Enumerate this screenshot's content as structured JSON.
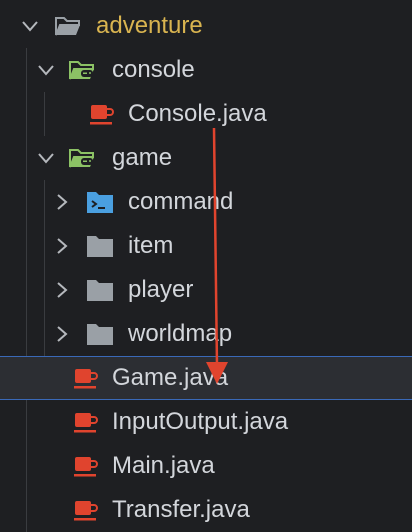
{
  "tree": {
    "items": [
      {
        "label": "adventure",
        "kind": "package",
        "expanded": true
      },
      {
        "label": "console",
        "kind": "game-folder",
        "expanded": true
      },
      {
        "label": "Console.java",
        "kind": "java-file"
      },
      {
        "label": "game",
        "kind": "game-folder",
        "expanded": true
      },
      {
        "label": "command",
        "kind": "command-folder",
        "expanded": false
      },
      {
        "label": "item",
        "kind": "folder",
        "expanded": false
      },
      {
        "label": "player",
        "kind": "folder",
        "expanded": false
      },
      {
        "label": "worldmap",
        "kind": "folder",
        "expanded": false
      },
      {
        "label": "Game.java",
        "kind": "java-file",
        "selected": true
      },
      {
        "label": "InputOutput.java",
        "kind": "java-file"
      },
      {
        "label": "Main.java",
        "kind": "java-file"
      },
      {
        "label": "Transfer.java",
        "kind": "java-file"
      }
    ]
  },
  "annotation": {
    "kind": "move-arrow",
    "from": "Console.java",
    "to": "Game.java",
    "color": "#e0442e"
  },
  "colors": {
    "background": "#1e1f22",
    "text": "#d3d6db",
    "package_text": "#d9b450",
    "selection_border": "#3a69b8",
    "java_icon": "#e0442e",
    "folder_icon": "#9aa0a6",
    "game_folder_icon": "#8cc265",
    "command_folder_icon": "#4a9fe0"
  }
}
